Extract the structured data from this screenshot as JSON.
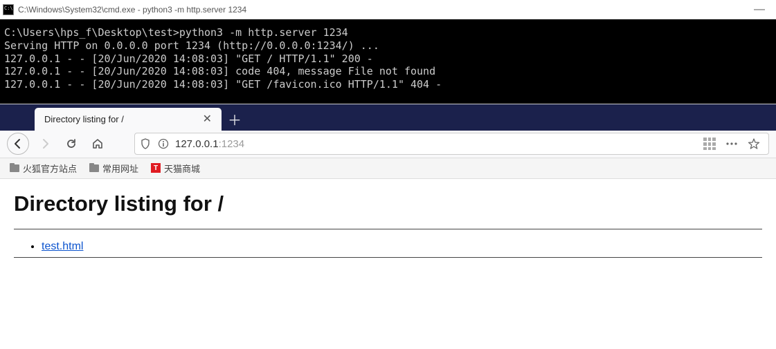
{
  "cmd": {
    "title": "C:\\Windows\\System32\\cmd.exe - python3  -m http.server 1234",
    "lines": [
      "C:\\Users\\hps_f\\Desktop\\test>python3 -m http.server 1234",
      "Serving HTTP on 0.0.0.0 port 1234 (http://0.0.0.0:1234/) ...",
      "127.0.0.1 - - [20/Jun/2020 14:08:03] \"GET / HTTP/1.1\" 200 -",
      "127.0.0.1 - - [20/Jun/2020 14:08:03] code 404, message File not found",
      "127.0.0.1 - - [20/Jun/2020 14:08:03] \"GET /favicon.ico HTTP/1.1\" 404 -"
    ]
  },
  "browser": {
    "tab_title": "Directory listing for /",
    "address_host": "127.0.0.1",
    "address_port": ":1234",
    "bookmarks": [
      {
        "label": "火狐官方站点",
        "type": "folder"
      },
      {
        "label": "常用网址",
        "type": "folder"
      },
      {
        "label": "天猫商城",
        "type": "tmall"
      }
    ],
    "page": {
      "heading": "Directory listing for /",
      "files": [
        {
          "name": "test.html"
        }
      ]
    }
  }
}
